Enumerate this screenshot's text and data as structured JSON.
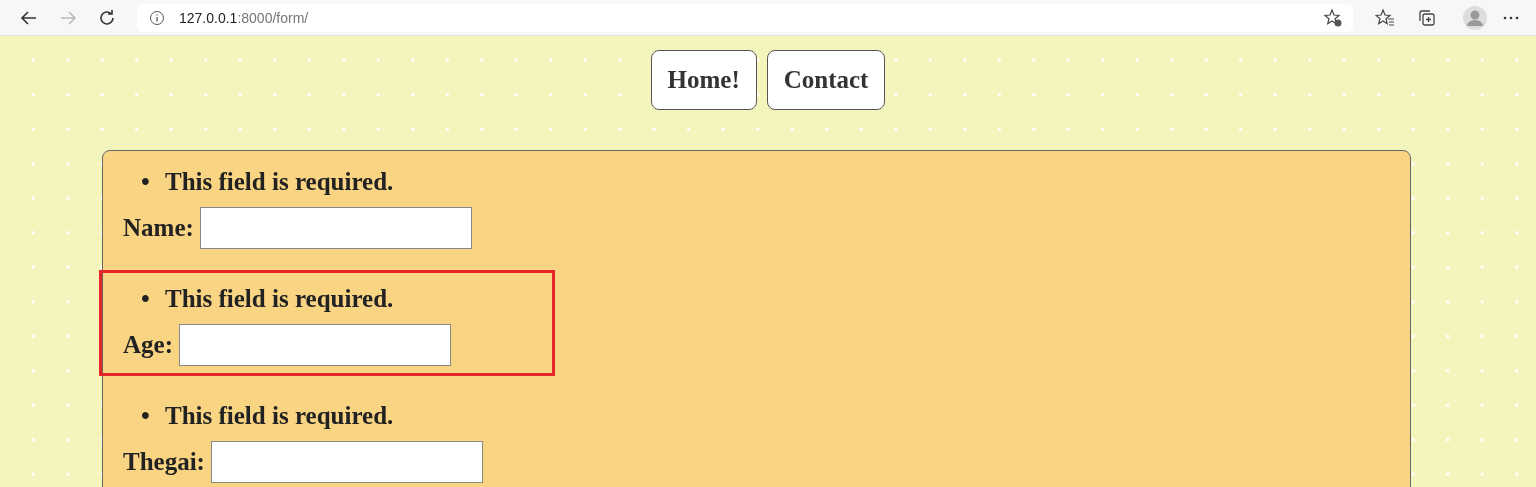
{
  "browser": {
    "url_host": "127.0.0.1",
    "url_path": ":8000/form/"
  },
  "nav": [
    {
      "label": "Home!"
    },
    {
      "label": "Contact"
    }
  ],
  "fields": [
    {
      "bullet": "•",
      "error": "This field is required.",
      "label": "Name:",
      "highlighted": false
    },
    {
      "bullet": "•",
      "error": "This field is required.",
      "label": "Age:",
      "highlighted": true
    },
    {
      "bullet": "•",
      "error": "This field is required.",
      "label": "Thegai:",
      "highlighted": false
    }
  ]
}
